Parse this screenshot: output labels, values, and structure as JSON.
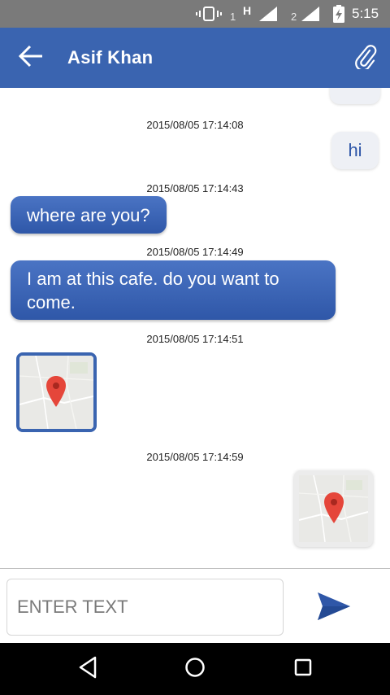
{
  "status_bar": {
    "sim1_label": "1",
    "network_type": "H",
    "sim2_label": "2",
    "time": "5:15",
    "icons": [
      "vibrate-icon",
      "signal-icon",
      "signal-icon",
      "battery-charging-icon"
    ]
  },
  "app_bar": {
    "title": "Asif  Khan",
    "back_icon": "arrow-left-icon",
    "attach_icon": "paperclip-icon",
    "color": "#3a64b0"
  },
  "messages": [
    {
      "type": "timestamp",
      "text": "2015/08/05 17:14:08"
    },
    {
      "type": "outgoing-text",
      "text": "hi"
    },
    {
      "type": "timestamp",
      "text": "2015/08/05 17:14:43"
    },
    {
      "type": "incoming-text",
      "text": "where are you?"
    },
    {
      "type": "timestamp",
      "text": "2015/08/05 17:14:49"
    },
    {
      "type": "incoming-text",
      "text": "I am at this cafe. do you want to come."
    },
    {
      "type": "timestamp",
      "text": "2015/08/05 17:14:51"
    },
    {
      "type": "incoming-location",
      "icon": "map-pin-icon"
    },
    {
      "type": "timestamp",
      "text": "2015/08/05 17:14:59"
    },
    {
      "type": "outgoing-location",
      "icon": "map-pin-icon"
    }
  ],
  "composer": {
    "placeholder": "ENTER TEXT",
    "send_icon": "send-icon",
    "accent": "#2f57a8"
  },
  "nav_bar": {
    "icons": [
      "nav-back-icon",
      "nav-home-icon",
      "nav-recents-icon"
    ]
  },
  "colors": {
    "incoming_bubble": "#3a64b0",
    "outgoing_bubble": "#eef0f5",
    "map_pin": "#e5463a"
  }
}
